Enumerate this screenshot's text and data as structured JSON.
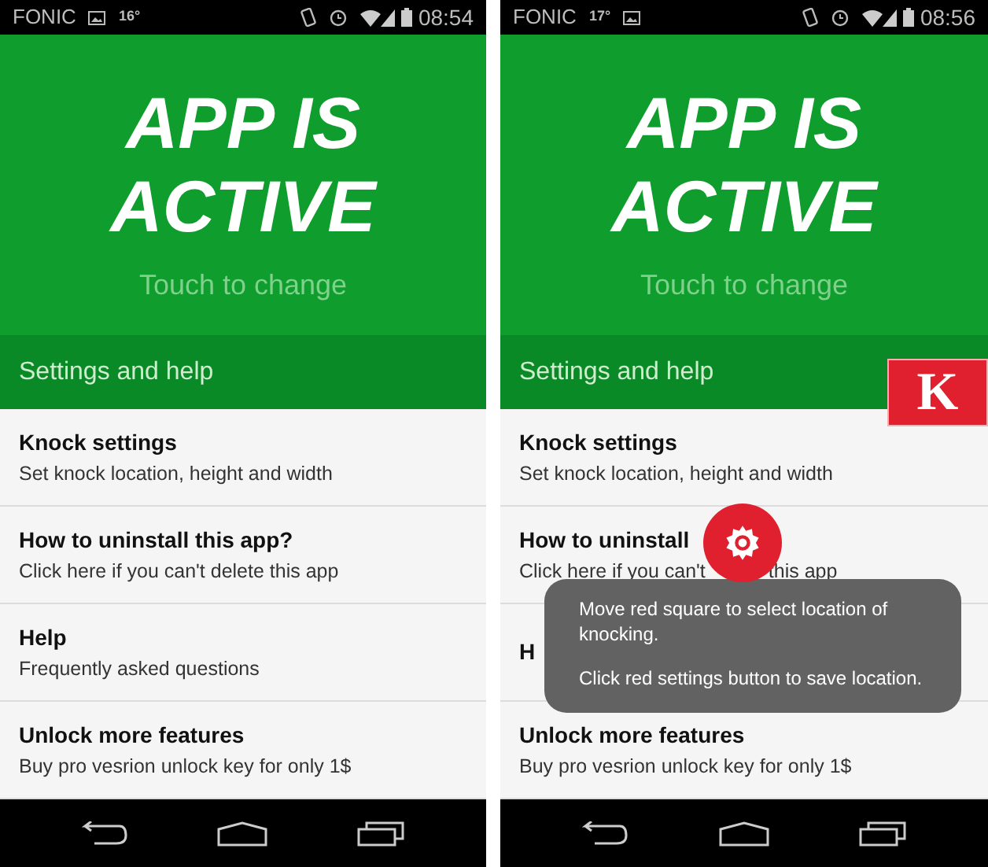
{
  "phones": [
    {
      "status_bar": {
        "left": [
          {
            "kind": "text",
            "text": "FONIC"
          },
          {
            "kind": "image"
          },
          {
            "kind": "small",
            "text": "16°"
          }
        ],
        "time": "08:54"
      },
      "hero": {
        "lines": [
          "APP IS",
          "ACTIVE"
        ],
        "hint": "Touch to change"
      },
      "section_header": "Settings and help",
      "items": [
        {
          "title": "Knock settings",
          "subtitle": "Set knock location, height and width"
        },
        {
          "title": "How to uninstall this app?",
          "subtitle": "Click here if you can't delete this app"
        },
        {
          "title": "Help",
          "subtitle": "Frequently asked questions"
        },
        {
          "title": "Unlock more features",
          "subtitle": "Buy pro vesrion unlock key for only 1$"
        }
      ]
    },
    {
      "status_bar": {
        "left": [
          {
            "kind": "text",
            "text": "FONIC"
          },
          {
            "kind": "small",
            "text": "17°"
          },
          {
            "kind": "image"
          }
        ],
        "time": "08:56"
      },
      "hero": {
        "lines": [
          "APP IS",
          "ACTIVE"
        ],
        "hint": "Touch to change"
      },
      "section_header": "Settings and help",
      "items": [
        {
          "title": "Knock settings",
          "subtitle": "Set knock location, height and width"
        },
        {
          "title": "How to uninstall",
          "subtitle": "Click here if you can't",
          "subtitle_tail": "this app"
        },
        {
          "title": "H"
        },
        {
          "title": "Unlock more features",
          "subtitle": "Buy pro vesrion unlock key for only 1$"
        }
      ],
      "overlay": {
        "badge": "K",
        "toast": [
          "Move red square to select location of knocking.",
          "Click red settings button to save location."
        ]
      }
    }
  ]
}
